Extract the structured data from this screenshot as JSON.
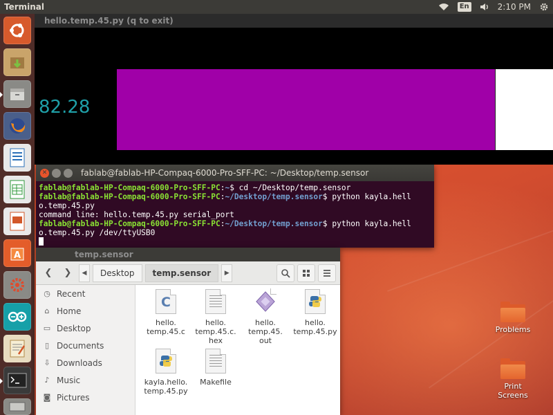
{
  "top_panel": {
    "app_name": "Terminal",
    "keyboard_layout": "En",
    "clock": "2:10 PM",
    "icons": [
      "wifi-icon",
      "volume-icon",
      "settings-gear-icon"
    ]
  },
  "launcher": {
    "items": [
      "ubuntu-dash",
      "software-updater",
      "files-manager",
      "firefox",
      "libreoffice-writer",
      "libreoffice-calc",
      "libreoffice-impress",
      "ubuntu-software",
      "system-settings",
      "arduino",
      "text-editor",
      "terminal",
      "usb-disk"
    ]
  },
  "plot_window": {
    "title": "hello.temp.45.py (q to exit)",
    "value": "82.28",
    "bar_fraction": 0.868,
    "colors": {
      "value": "#1fa0a8",
      "bar": "#a000a8",
      "background": "#000000",
      "track": "#ffffff"
    }
  },
  "terminal": {
    "title": "fablab@fablab-HP-Compaq-6000-Pro-SFF-PC: ~/Desktop/temp.sensor",
    "lines": [
      {
        "user": "fablab@fablab-HP-Compaq-6000-Pro-SFF-PC",
        "sep": ":",
        "path": "~",
        "cmd": "$ cd ~/Desktop/temp.sensor"
      },
      {
        "user": "fablab@fablab-HP-Compaq-6000-Pro-SFF-PC",
        "sep": ":",
        "path": "~/Desktop/temp.sensor",
        "cmd": "$ python kayla.hell",
        "wrap": "o.temp.45.py"
      },
      {
        "plain": "command line: hello.temp.45.py serial_port"
      },
      {
        "user": "fablab@fablab-HP-Compaq-6000-Pro-SFF-PC",
        "sep": ":",
        "path": "~/Desktop/temp.sensor",
        "cmd": "$ python kayla.hell",
        "wrap": "o.temp.45.py /dev/ttyUSB0"
      }
    ]
  },
  "file_manager": {
    "title": "temp.sensor",
    "breadcrumbs": [
      "Desktop",
      "temp.sensor"
    ],
    "sidebar": [
      {
        "label": "Recent",
        "icon": "clock-icon"
      },
      {
        "label": "Home",
        "icon": "home-icon"
      },
      {
        "label": "Desktop",
        "icon": "desktop-folder-icon"
      },
      {
        "label": "Documents",
        "icon": "documents-icon"
      },
      {
        "label": "Downloads",
        "icon": "download-icon"
      },
      {
        "label": "Music",
        "icon": "music-icon"
      },
      {
        "label": "Pictures",
        "icon": "camera-icon"
      }
    ],
    "files": [
      {
        "name": "hello.\ntemp.45.c",
        "type": "c-source"
      },
      {
        "name": "hello.\ntemp.45.c.\nhex",
        "type": "text"
      },
      {
        "name": "hello.\ntemp.45.\nout",
        "type": "binary"
      },
      {
        "name": "hello.\ntemp.45.py",
        "type": "python"
      },
      {
        "name": "kayla.hello.\ntemp.45.py",
        "type": "python"
      },
      {
        "name": "Makefile",
        "type": "text"
      }
    ]
  },
  "desktop": {
    "icons": [
      {
        "label": "Problems"
      },
      {
        "label": "Print\nScreens"
      }
    ]
  }
}
